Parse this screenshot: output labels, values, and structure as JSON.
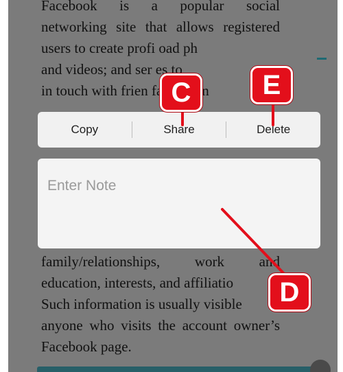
{
  "document": {
    "top_lines": [
      "Facebook    is    a    popular    social",
      "networking site that allows registered",
      "users to create profi       oad ph",
      "and videos; and ser         es to",
      "in  touch  with  frien      family,  an"
    ],
    "bottom_lines": [
      "family/relationships,       work       and",
      "education, interests, and affiliatio",
      "Such information is usually visible",
      "anyone who visits the account owner’s",
      "Facebook page."
    ]
  },
  "menu": {
    "copy_label": "Copy",
    "share_label": "Share",
    "delete_label": "Delete"
  },
  "note": {
    "placeholder": "Enter Note",
    "value": ""
  },
  "callouts": {
    "c": "C",
    "d": "D",
    "e": "E",
    "color": "#e30f1b"
  }
}
